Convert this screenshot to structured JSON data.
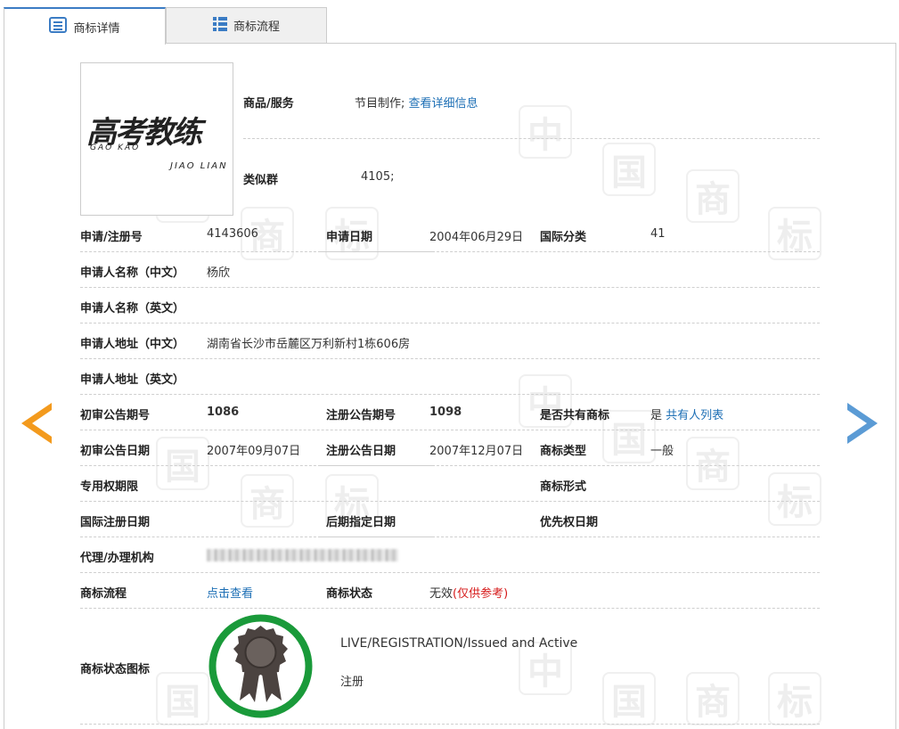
{
  "tabs": [
    {
      "label": "商标详情",
      "icon": "list-icon",
      "active": true
    },
    {
      "label": "商标流程",
      "icon": "grid-list-icon",
      "active": false
    }
  ],
  "watermark_chars": [
    "中",
    "国",
    "商",
    "标"
  ],
  "logo": {
    "cn": "高考教练",
    "gk": "GAO KAO",
    "jl": "JIAO LIAN"
  },
  "goods": {
    "label": "商品/服务",
    "value": "节目制作;",
    "link": "查看详细信息"
  },
  "similar": {
    "label": "类似群",
    "value": "4105;"
  },
  "rows": {
    "reg_no": {
      "label": "申请/注册号",
      "value": "4143606"
    },
    "apply_date": {
      "label": "申请日期",
      "value": "2004年06月29日"
    },
    "intl_class": {
      "label": "国际分类",
      "value": "41"
    },
    "applicant_cn": {
      "label": "申请人名称（中文）",
      "value": "杨欣"
    },
    "applicant_en": {
      "label": "申请人名称（英文）",
      "value": ""
    },
    "address_cn": {
      "label": "申请人地址（中文）",
      "value": "湖南省长沙市岳麓区万利新村1栋606房"
    },
    "address_en": {
      "label": "申请人地址（英文）",
      "value": ""
    },
    "prelim_no": {
      "label": "初审公告期号",
      "value": "1086"
    },
    "reg_pub_no": {
      "label": "注册公告期号",
      "value": "1098"
    },
    "shared": {
      "label": "是否共有商标",
      "value": "是",
      "link": "共有人列表"
    },
    "prelim_date": {
      "label": "初审公告日期",
      "value": "2007年09月07日"
    },
    "reg_pub_date": {
      "label": "注册公告日期",
      "value": "2007年12月07日"
    },
    "mark_type": {
      "label": "商标类型",
      "value": "一般"
    },
    "exclusive": {
      "label": "专用权期限",
      "value": ""
    },
    "mark_form": {
      "label": "商标形式",
      "value": ""
    },
    "intl_reg_date": {
      "label": "国际注册日期",
      "value": ""
    },
    "later_date": {
      "label": "后期指定日期",
      "value": ""
    },
    "priority_date": {
      "label": "优先权日期",
      "value": ""
    },
    "agent": {
      "label": "代理/办理机构",
      "value": ""
    },
    "process": {
      "label": "商标流程",
      "link": "点击查看"
    },
    "status": {
      "label": "商标状态",
      "value": "无效",
      "note": "(仅供参考)"
    },
    "status_icon": {
      "label": "商标状态图标",
      "en": "LIVE/REGISTRATION/Issued and Active",
      "cn": "注册"
    }
  },
  "colors": {
    "accent": "#1d6fb5",
    "orange": "#f39a1d",
    "blue": "#5b9bd5",
    "green": "#1a9a3a",
    "red": "#d61a1a"
  }
}
